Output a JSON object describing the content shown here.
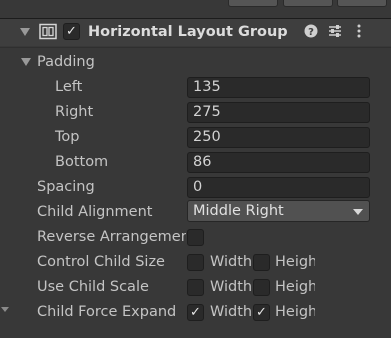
{
  "component": {
    "title": "Horizontal Layout Group",
    "enabled": true,
    "icons": [
      "help-icon",
      "presets-icon",
      "more-options-icon"
    ]
  },
  "padding": {
    "label": "Padding",
    "left_label": "Left",
    "left": "135",
    "right_label": "Right",
    "right": "275",
    "top_label": "Top",
    "top": "250",
    "bottom_label": "Bottom",
    "bottom": "86"
  },
  "spacing": {
    "label": "Spacing",
    "value": "0"
  },
  "child_alignment": {
    "label": "Child Alignment",
    "value": "Middle Right"
  },
  "reverse_arrangement": {
    "label": "Reverse Arrangement",
    "checked": false
  },
  "control_child_size": {
    "label": "Control Child Size",
    "width_label": "Width",
    "height_label": "Height",
    "width": false,
    "height": false
  },
  "use_child_scale": {
    "label": "Use Child Scale",
    "width_label": "Width",
    "height_label": "Height",
    "width": false,
    "height": false
  },
  "child_force_expand": {
    "label": "Child Force Expand",
    "width_label": "Width",
    "height_label": "Height",
    "width": true,
    "height": true
  },
  "check_glyph": "✓",
  "colors": {
    "panel": "#383838",
    "header": "#3e3e3e",
    "field": "#2a2a2a",
    "dropdown": "#515151",
    "text": "#c4c4c4"
  }
}
